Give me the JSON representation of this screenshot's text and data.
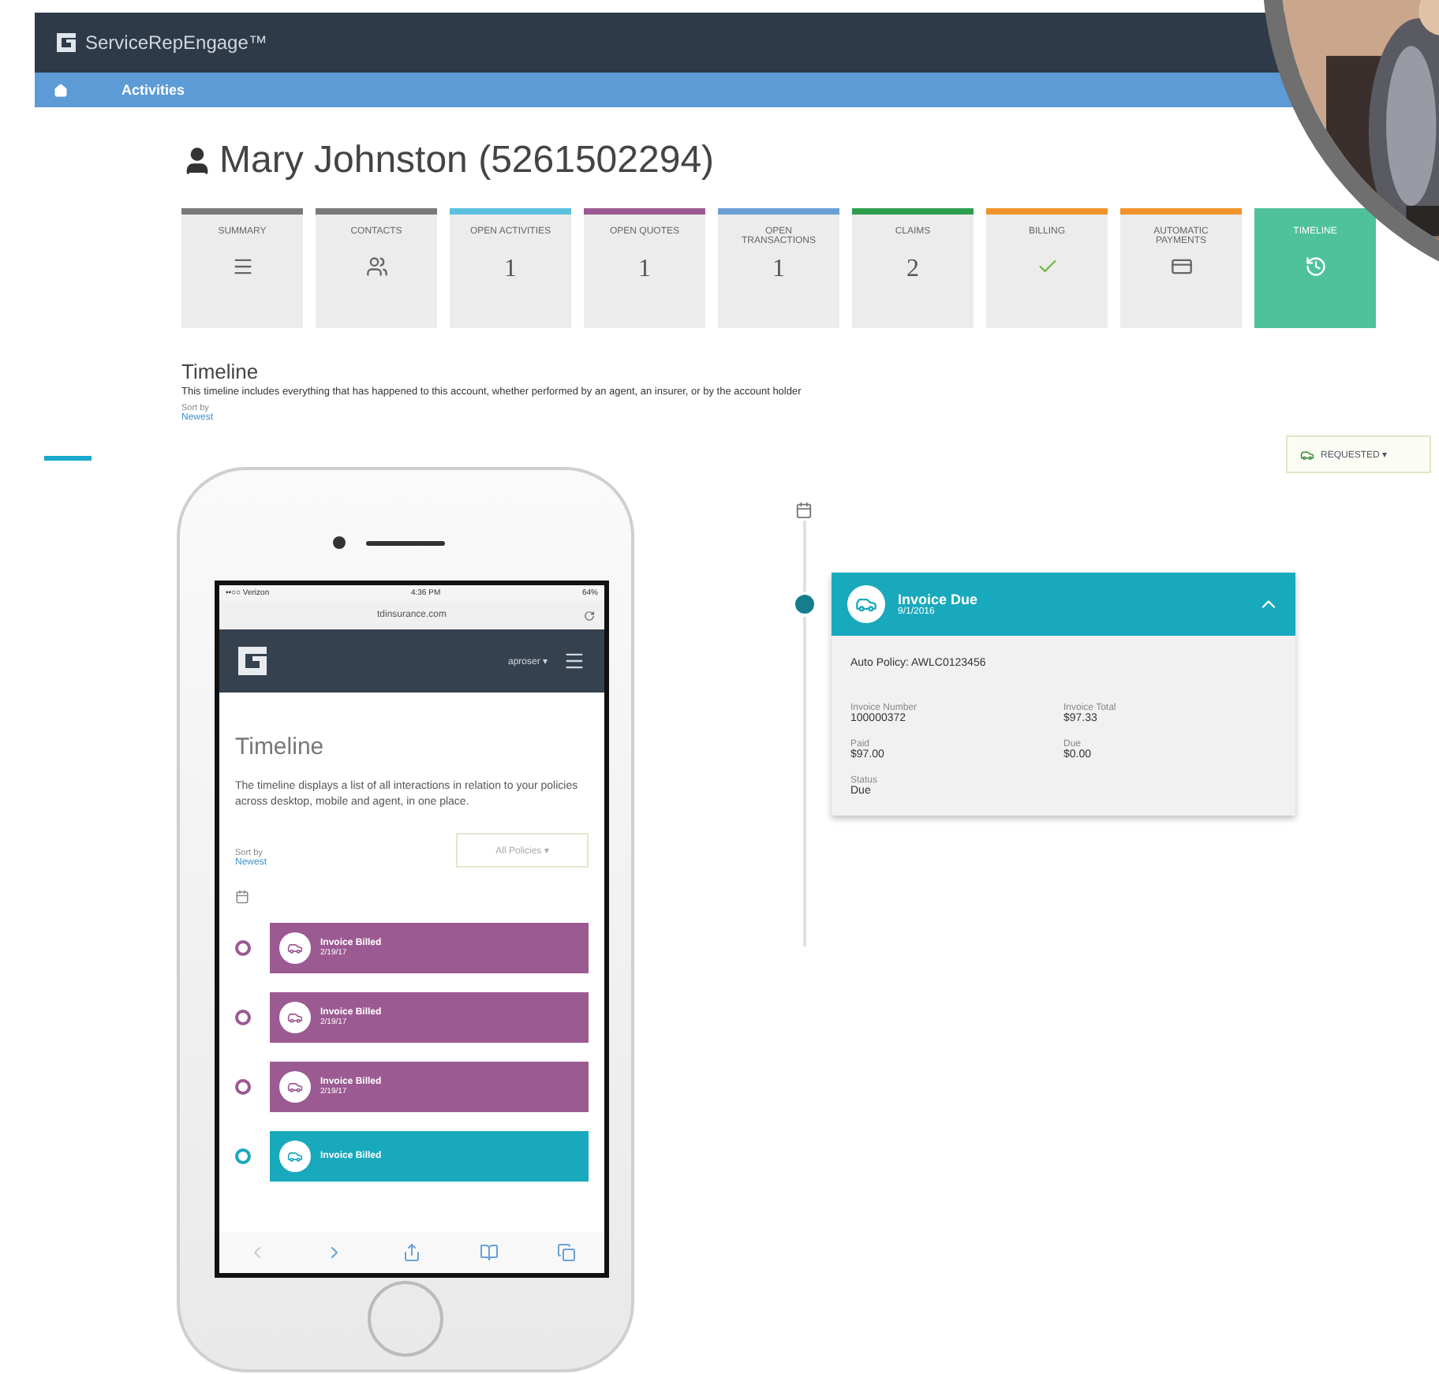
{
  "app": {
    "brand": "ServiceRepEngage™"
  },
  "nav": {
    "items": [
      {
        "label": "Activities",
        "selected": true
      }
    ]
  },
  "customer": {
    "name": "Mary Johnston (5261502294)"
  },
  "tiles": [
    {
      "label": "SUMMARY",
      "kind": "icon",
      "color": "#7a7a7a",
      "selected": false
    },
    {
      "label": "CONTACTS",
      "kind": "icon",
      "color": "#7a7a7a",
      "selected": false
    },
    {
      "label": "OPEN ACTIVITIES",
      "kind": "count",
      "value": "1",
      "color": "#5bc0de",
      "selected": false
    },
    {
      "label": "OPEN QUOTES",
      "kind": "count",
      "value": "1",
      "color": "#9b5a92",
      "selected": false
    },
    {
      "label": "OPEN TRANSACTIONS",
      "kind": "count",
      "value": "1",
      "color": "#6a9fd4",
      "selected": false
    },
    {
      "label": "CLAIMS",
      "kind": "count",
      "value": "2",
      "color": "#2e9e4f",
      "selected": false
    },
    {
      "label": "BILLING",
      "kind": "icon",
      "color": "#f0932b",
      "selected": false
    },
    {
      "label": "AUTOMATIC PAYMENTS",
      "kind": "icon",
      "color": "#f0932b",
      "selected": false
    },
    {
      "label": "TIMELINE",
      "kind": "icon",
      "color": "#4fc29c",
      "selected": true
    }
  ],
  "timeline": {
    "title": "Timeline",
    "description": "This timeline includes everything that has happened to this account, whether performed by an agent, an insurer, or by the account holder",
    "sort_label": "Sort by",
    "sort_value": "Newest",
    "filter": "REQUESTED ▾"
  },
  "event": {
    "title": "Invoice Due",
    "date": "9/1/2016",
    "expanded": true,
    "policy": "Auto Policy: AWLC0123456",
    "fields": [
      {
        "label": "Invoice Number",
        "value": "100000372"
      },
      {
        "label": "Invoice Total",
        "value": "$97.33"
      },
      {
        "label": "Paid",
        "value": "$97.00"
      },
      {
        "label": "Due",
        "value": "$0.00"
      },
      {
        "label": "Status",
        "value": "Due"
      }
    ]
  },
  "phone": {
    "carrier": "••○○ Verizon",
    "time": "4:36 PM",
    "battery": "64%",
    "url": "tdinsurance.com",
    "user": "aproser ▾",
    "title": "Timeline",
    "description": "The timeline displays a list of all interactions in relation to your policies across desktop, mobile and agent, in one place.",
    "sort_label": "Sort by",
    "sort_value": "Newest",
    "filter": "All Policies ▾",
    "events": [
      {
        "title": "Invoice Billed",
        "date": "2/19/17",
        "color": "#9b5a92"
      },
      {
        "title": "Invoice Billed",
        "date": "2/19/17",
        "color": "#9b5a92"
      },
      {
        "title": "Invoice Billed",
        "date": "2/19/17",
        "color": "#9b5a92"
      },
      {
        "title": "Invoice Billed",
        "color": "#19a9bd"
      }
    ]
  }
}
